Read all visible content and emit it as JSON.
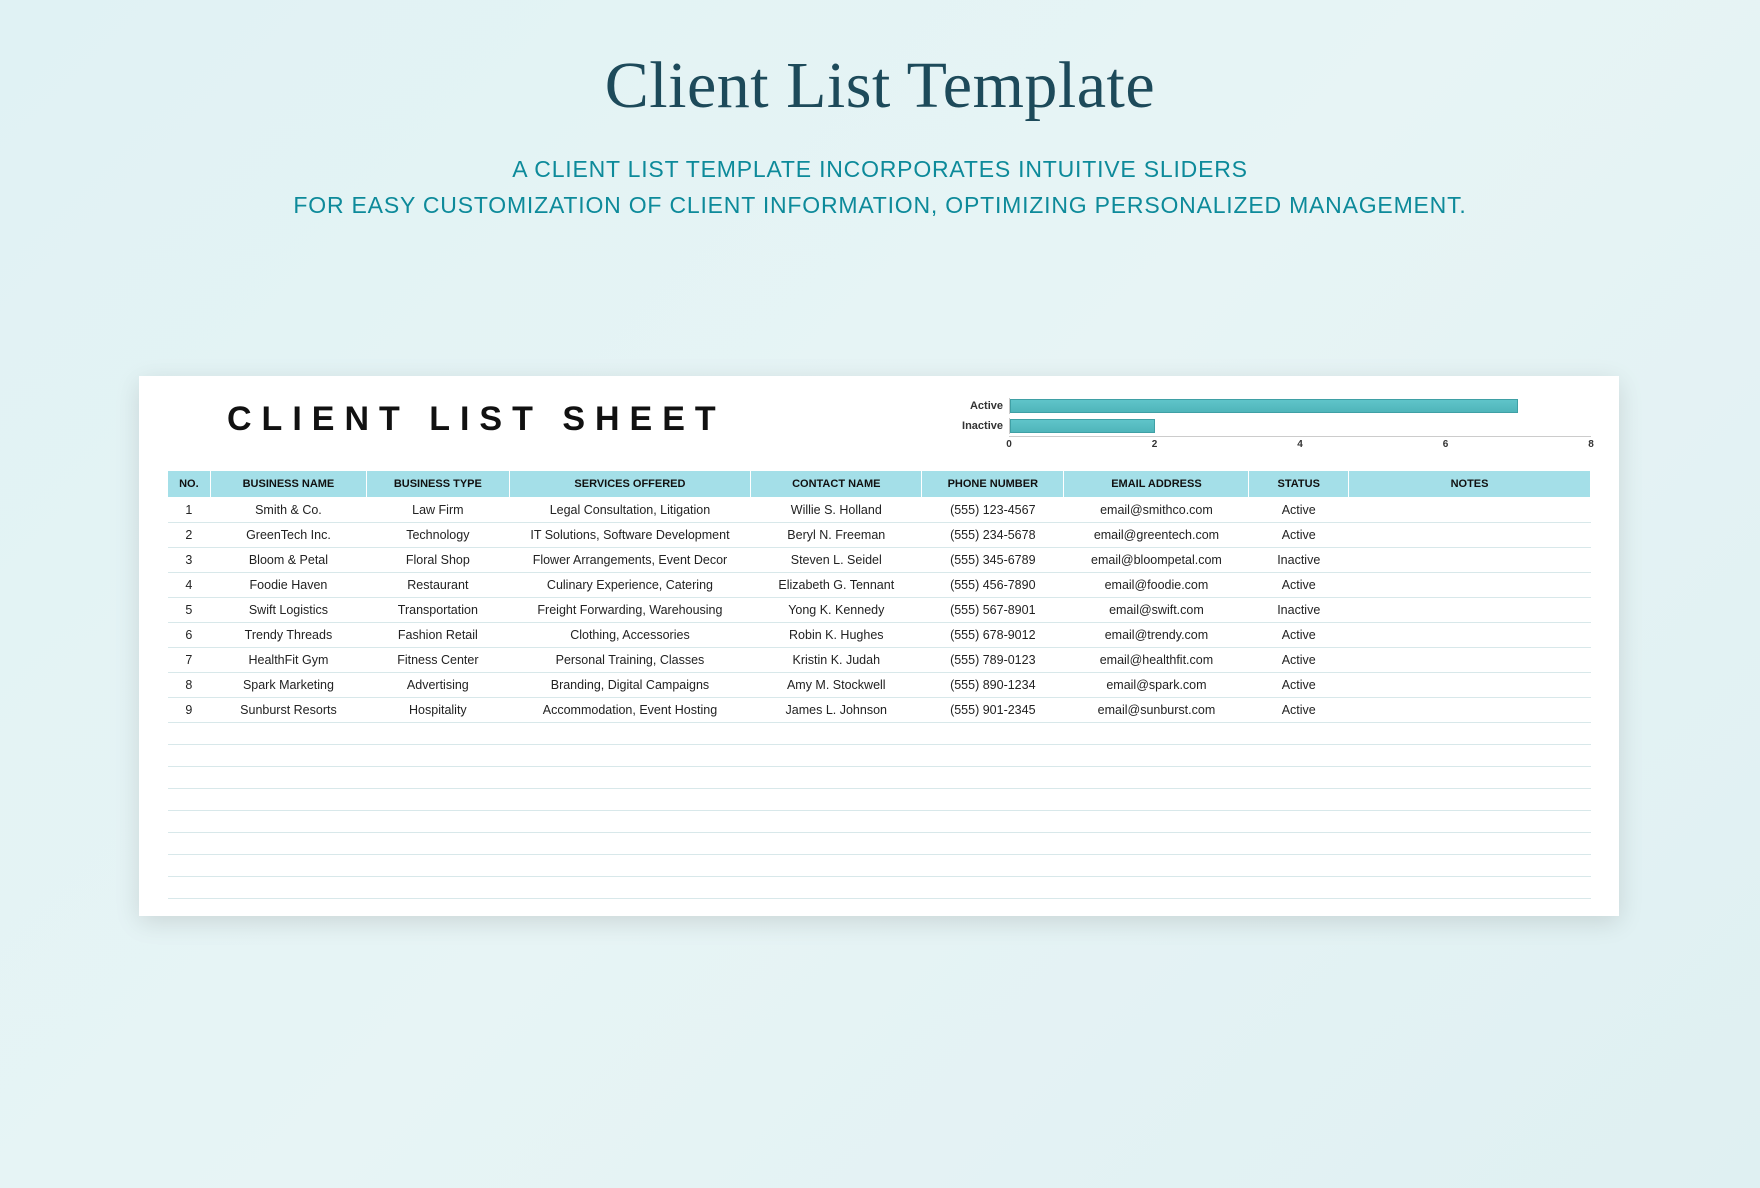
{
  "page": {
    "title": "Client List Template",
    "subtitle_line1": "A CLIENT LIST TEMPLATE INCORPORATES INTUITIVE SLIDERS",
    "subtitle_line2": "FOR EASY CUSTOMIZATION OF CLIENT INFORMATION, OPTIMIZING PERSONALIZED MANAGEMENT."
  },
  "sheet": {
    "title": "CLIENT LIST SHEET",
    "columns": [
      "NO.",
      "BUSINESS NAME",
      "BUSINESS TYPE",
      "SERVICES OFFERED",
      "CONTACT NAME",
      "PHONE NUMBER",
      "EMAIL ADDRESS",
      "STATUS",
      "NOTES"
    ],
    "rows": [
      {
        "no": "1",
        "business": "Smith & Co.",
        "type": "Law Firm",
        "services": "Legal Consultation, Litigation",
        "contact": "Willie S. Holland",
        "phone": "(555) 123-4567",
        "email": "email@smithco.com",
        "status": "Active",
        "notes": ""
      },
      {
        "no": "2",
        "business": "GreenTech Inc.",
        "type": "Technology",
        "services": "IT Solutions, Software Development",
        "contact": "Beryl N. Freeman",
        "phone": "(555) 234-5678",
        "email": "email@greentech.com",
        "status": "Active",
        "notes": ""
      },
      {
        "no": "3",
        "business": "Bloom & Petal",
        "type": "Floral Shop",
        "services": "Flower Arrangements, Event Decor",
        "contact": "Steven L. Seidel",
        "phone": "(555) 345-6789",
        "email": "email@bloompetal.com",
        "status": "Inactive",
        "notes": ""
      },
      {
        "no": "4",
        "business": "Foodie Haven",
        "type": "Restaurant",
        "services": "Culinary Experience, Catering",
        "contact": "Elizabeth G. Tennant",
        "phone": "(555) 456-7890",
        "email": "email@foodie.com",
        "status": "Active",
        "notes": ""
      },
      {
        "no": "5",
        "business": "Swift Logistics",
        "type": "Transportation",
        "services": "Freight Forwarding, Warehousing",
        "contact": "Yong K. Kennedy",
        "phone": "(555) 567-8901",
        "email": "email@swift.com",
        "status": "Inactive",
        "notes": ""
      },
      {
        "no": "6",
        "business": "Trendy Threads",
        "type": "Fashion Retail",
        "services": "Clothing, Accessories",
        "contact": "Robin K. Hughes",
        "phone": "(555) 678-9012",
        "email": "email@trendy.com",
        "status": "Active",
        "notes": ""
      },
      {
        "no": "7",
        "business": "HealthFit Gym",
        "type": "Fitness Center",
        "services": "Personal Training, Classes",
        "contact": "Kristin K. Judah",
        "phone": "(555) 789-0123",
        "email": "email@healthfit.com",
        "status": "Active",
        "notes": ""
      },
      {
        "no": "8",
        "business": "Spark Marketing",
        "type": "Advertising",
        "services": "Branding, Digital Campaigns",
        "contact": "Amy M. Stockwell",
        "phone": "(555) 890-1234",
        "email": "email@spark.com",
        "status": "Active",
        "notes": ""
      },
      {
        "no": "9",
        "business": "Sunburst Resorts",
        "type": "Hospitality",
        "services": "Accommodation, Event Hosting",
        "contact": "James L. Johnson",
        "phone": "(555) 901-2345",
        "email": "email@sunburst.com",
        "status": "Active",
        "notes": ""
      }
    ],
    "empty_rows": 8
  },
  "chart_data": {
    "type": "bar",
    "categories": [
      "Active",
      "Inactive"
    ],
    "values": [
      7,
      2
    ],
    "xlabel": "",
    "ylabel": "",
    "xlim": [
      0,
      8
    ],
    "ticks": [
      0,
      2,
      4,
      6,
      8
    ]
  }
}
